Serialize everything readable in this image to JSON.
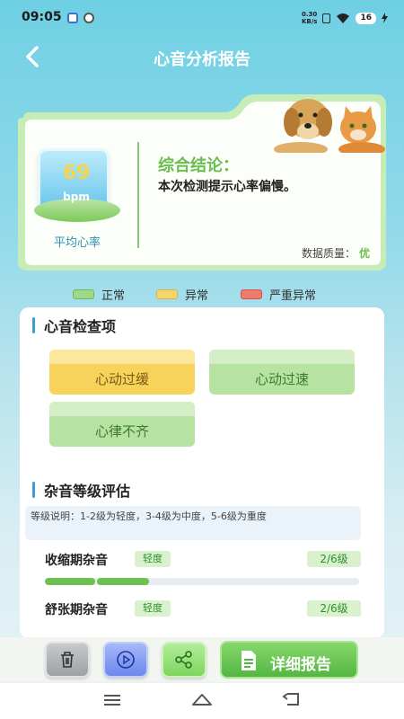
{
  "status": {
    "time": "09:05",
    "net_speed": "0.30\nKB/s",
    "battery": "16"
  },
  "header": {
    "title": "心音分析报告"
  },
  "summary": {
    "heart_rate": "69",
    "unit": "bpm",
    "hr_label": "平均心率",
    "conclusion_title": "综合结论：",
    "conclusion_text": "本次检测提示心率偏慢。",
    "quality_label": "数据质量：",
    "quality_value": "优"
  },
  "legend": [
    {
      "label": "正常",
      "color": "#9ed98a"
    },
    {
      "label": "异常",
      "color": "#f5d66a"
    },
    {
      "label": "严重异常",
      "color": "#f07a70"
    }
  ],
  "checks": {
    "title": "心音检查项",
    "items": [
      {
        "label": "心动过缓",
        "state": "abnormal"
      },
      {
        "label": "心动过速",
        "state": "normal"
      },
      {
        "label": "心律不齐",
        "state": "normal"
      }
    ]
  },
  "murmur": {
    "title": "杂音等级评估",
    "note": "等级说明：1-2级为轻度，3-4级为中度，5-6级为重度",
    "rows": [
      {
        "name": "收缩期杂音",
        "badge": "轻度",
        "grade": "2/6级",
        "level": 0.333
      },
      {
        "name": "舒张期杂音",
        "badge": "轻度",
        "grade": "2/6级"
      }
    ]
  },
  "toolbar": {
    "report_label": "详细报告"
  }
}
